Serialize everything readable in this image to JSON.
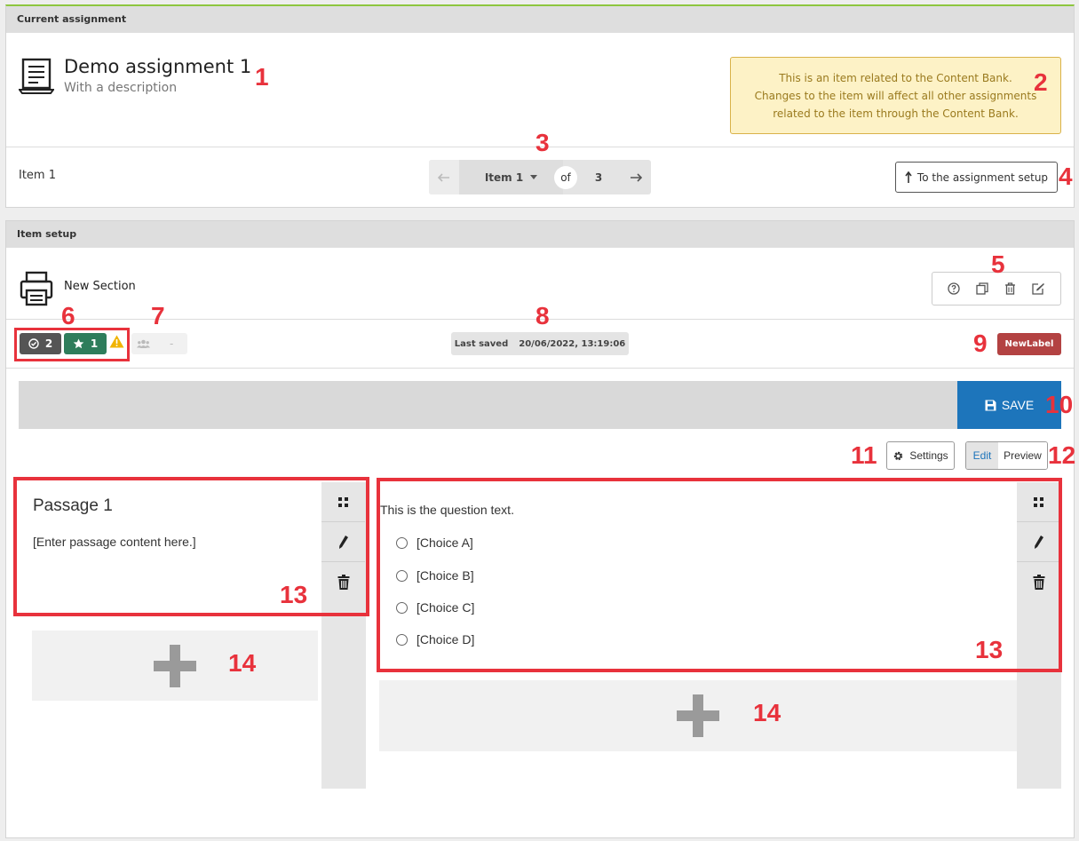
{
  "current_assignment": {
    "header": "Current assignment",
    "title": "Demo assignment 1",
    "description": "With a description",
    "notice": {
      "line1": "This is an item related to the Content Bank.",
      "line2": "Changes to the item will affect all other assignments",
      "line3": "related to the item through the Content Bank."
    },
    "item_label": "Item 1",
    "pager": {
      "current": "Item 1",
      "of": "of",
      "total": "3"
    },
    "setup_button": "To the assignment setup"
  },
  "item_setup": {
    "header": "Item setup",
    "section_title": "New Section",
    "badges": {
      "check_count": "2",
      "star_count": "1",
      "group_value": "-"
    },
    "last_saved_label": "Last saved",
    "last_saved_value": "20/06/2022, 13:19:06",
    "new_label": "NewLabel",
    "save_label": "SAVE",
    "settings_label": "Settings",
    "edit_label": "Edit",
    "preview_label": "Preview",
    "passage": {
      "title": "Passage 1",
      "content": "[Enter passage content here.]"
    },
    "question": {
      "text": "This is the question text.",
      "choices": [
        "[Choice A]",
        "[Choice B]",
        "[Choice C]",
        "[Choice D]"
      ]
    }
  },
  "callouts": {
    "c1": "1",
    "c2": "2",
    "c3": "3",
    "c4": "4",
    "c5": "5",
    "c6": "6",
    "c7": "7",
    "c8": "8",
    "c9": "9",
    "c10": "10",
    "c11": "11",
    "c12": "12",
    "c13a": "13",
    "c13b": "13",
    "c14a": "14",
    "c14b": "14"
  },
  "colors": {
    "accent_green": "#8dc63f",
    "save_blue": "#1d75bb",
    "badge_dark": "#555555",
    "badge_green": "#2e7d5b",
    "label_red": "#b34242",
    "notice_bg": "#fdf2c6",
    "notice_border": "#d9b24a",
    "callout_red": "#e8323c"
  },
  "icons": [
    "document-icon",
    "arrow-left-icon",
    "caret-down-icon",
    "arrow-right-icon",
    "upload-arrow-icon",
    "printer-icon",
    "help-icon",
    "copy-icon",
    "trash-icon",
    "edit-icon",
    "check-circle-icon",
    "star-icon",
    "warning-icon",
    "users-icon",
    "floppy-icon",
    "gear-icon",
    "drag-handle-icon",
    "pencil-icon",
    "plus-icon"
  ]
}
